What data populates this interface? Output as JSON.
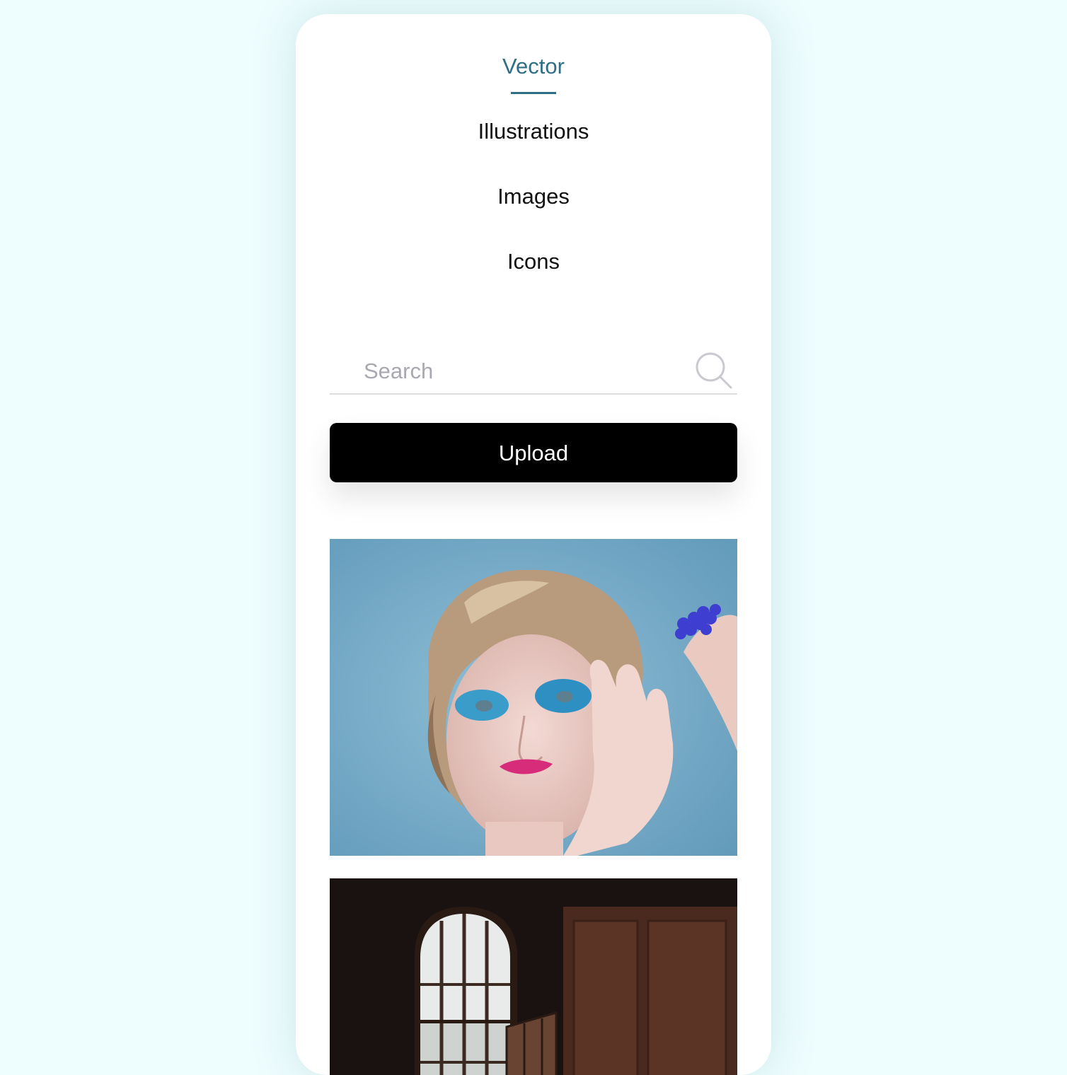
{
  "nav": {
    "items": [
      {
        "label": "Vector",
        "active": true
      },
      {
        "label": "Illustrations",
        "active": false
      },
      {
        "label": "Images",
        "active": false
      },
      {
        "label": "Icons",
        "active": false
      }
    ],
    "active_color": "#2f6f86"
  },
  "search": {
    "placeholder": "Search",
    "value": "",
    "icon": "search-icon"
  },
  "upload": {
    "label": "Upload"
  },
  "gallery": {
    "photos": [
      {
        "subject": "portrait-blue-eyeshadow"
      },
      {
        "subject": "dark-room-arched-window"
      }
    ]
  },
  "colors": {
    "background": "#eefdfe",
    "card": "#ffffff",
    "button": "#000000"
  }
}
